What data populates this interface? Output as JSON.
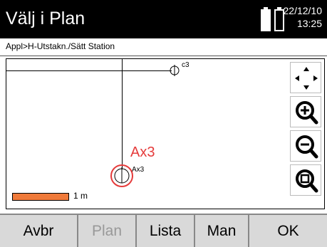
{
  "header": {
    "title": "Välj i Plan",
    "date": "22/12/10",
    "time": "13:25",
    "battery_icons": [
      "battery-full-icon",
      "battery-empty-icon"
    ]
  },
  "breadcrumb": "Appl>H-Utstakn./Sätt Station",
  "plan": {
    "points": [
      {
        "id": "c3",
        "label": "c3"
      },
      {
        "id": "Ax3",
        "label": "Ax3",
        "selected_label": "Ax3"
      }
    ],
    "scale_label": "1 m",
    "colors": {
      "selection": "#e53b3b",
      "scalebar": "#f07a3a"
    },
    "tools": [
      {
        "name": "pan-icon"
      },
      {
        "name": "zoom-in-icon"
      },
      {
        "name": "zoom-out-icon"
      },
      {
        "name": "zoom-fit-icon"
      }
    ]
  },
  "softkeys": [
    {
      "label": "Avbr",
      "enabled": true
    },
    {
      "label": "Plan",
      "enabled": false
    },
    {
      "label": "Lista",
      "enabled": true
    },
    {
      "label": "Man",
      "enabled": true
    },
    {
      "label": "OK",
      "enabled": true
    }
  ]
}
